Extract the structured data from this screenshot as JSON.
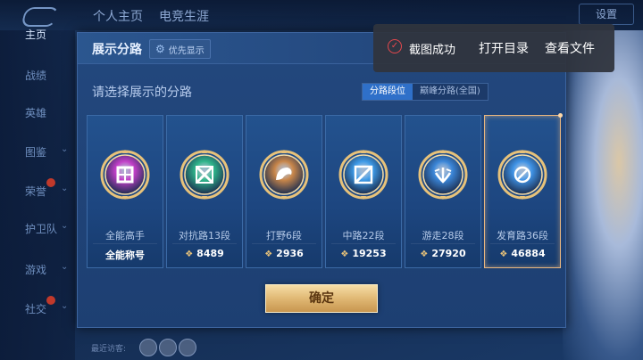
{
  "topbar": {
    "tabs": [
      "个人主页",
      "电竞生涯"
    ],
    "right_button": "设置"
  },
  "sidebar": {
    "items": [
      {
        "label": "主页",
        "active": true,
        "has_chevron": false,
        "badge": false
      },
      {
        "label": "战绩",
        "active": false,
        "has_chevron": false,
        "badge": false
      },
      {
        "label": "英雄",
        "active": false,
        "has_chevron": false,
        "badge": false
      },
      {
        "label": "图鉴",
        "active": false,
        "has_chevron": true,
        "badge": false
      },
      {
        "label": "荣誉",
        "active": false,
        "has_chevron": true,
        "badge": true
      },
      {
        "label": "护卫队",
        "active": false,
        "has_chevron": true,
        "badge": false
      },
      {
        "label": "游戏",
        "active": false,
        "has_chevron": true,
        "badge": false
      },
      {
        "label": "社交",
        "active": false,
        "has_chevron": true,
        "badge": true
      }
    ]
  },
  "bottom": {
    "recent_visitors": "最近访客:"
  },
  "panel": {
    "title": "展示分路",
    "priority_button": "优先显示",
    "prompt": "请选择展示的分路",
    "segments": [
      {
        "label": "分路段位",
        "on": true
      },
      {
        "label": "巅峰分路(全国)",
        "on": false
      }
    ],
    "cards": [
      {
        "label": "全能高手",
        "score": "全能称号",
        "show_icon": false,
        "selected": false,
        "emblem": "all-round-emblem-icon",
        "color": "#c23fc8"
      },
      {
        "label": "对抗路13段",
        "score": "8489",
        "show_icon": true,
        "selected": false,
        "emblem": "clash-lane-emblem-icon",
        "color": "#2fb58a"
      },
      {
        "label": "打野6段",
        "score": "2936",
        "show_icon": true,
        "selected": false,
        "emblem": "jungle-emblem-icon",
        "color": "#c8864a"
      },
      {
        "label": "中路22段",
        "score": "19253",
        "show_icon": true,
        "selected": false,
        "emblem": "mid-lane-emblem-icon",
        "color": "#3e9be8"
      },
      {
        "label": "游走28段",
        "score": "27920",
        "show_icon": true,
        "selected": false,
        "emblem": "roam-emblem-icon",
        "color": "#3b86d8"
      },
      {
        "label": "发育路36段",
        "score": "46884",
        "show_icon": true,
        "selected": true,
        "emblem": "farm-lane-emblem-icon",
        "color": "#3f93e6"
      }
    ],
    "confirm_button": "确定"
  },
  "toast": {
    "message": "截图成功",
    "action_open_dir": "打开目录",
    "action_view_file": "查看文件"
  }
}
